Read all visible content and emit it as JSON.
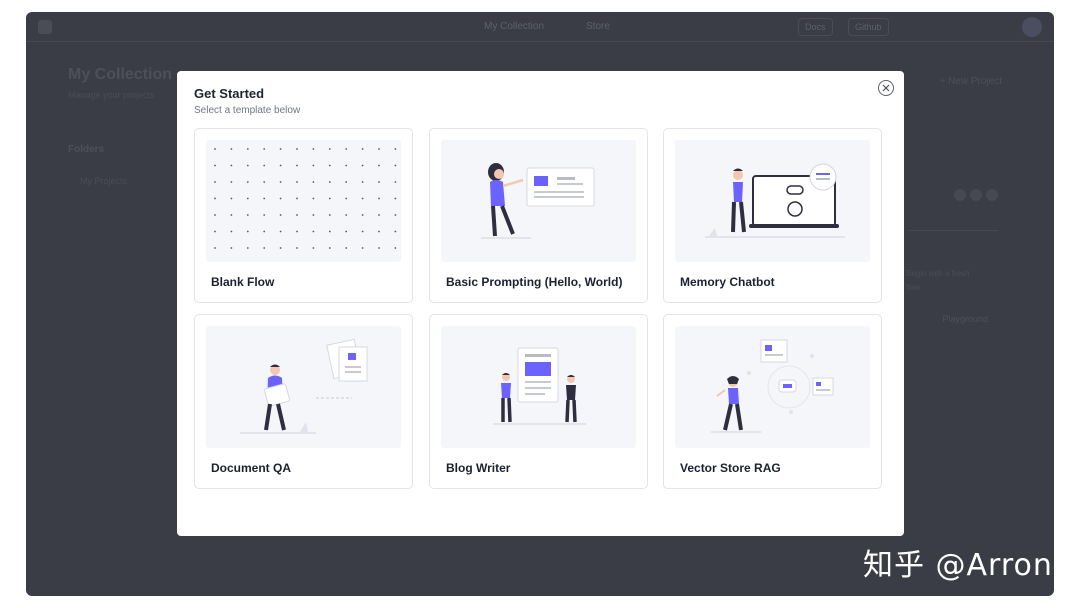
{
  "background_app": {
    "nav": [
      "My Collection",
      "Store"
    ],
    "top_pills": [
      "Docs",
      "Github"
    ],
    "page_title": "My Collection",
    "page_subtitle": "Manage your projects",
    "folders_heading": "Folders",
    "folder_item": "My Projects",
    "new_project_label": "+ New Project",
    "right_text": "Begin with a fresh flow",
    "right_button": "Playground"
  },
  "modal": {
    "title": "Get Started",
    "subtitle": "Select a template below",
    "close_icon": "close-icon",
    "templates": [
      {
        "label": "Blank Flow",
        "illustration": "dot-grid"
      },
      {
        "label": "Basic Prompting (Hello, World)",
        "illustration": "person-presenting-board"
      },
      {
        "label": "Memory Chatbot",
        "illustration": "person-with-laptop-bot"
      },
      {
        "label": "Document QA",
        "illustration": "person-holding-document"
      },
      {
        "label": "Blog Writer",
        "illustration": "two-people-with-document"
      },
      {
        "label": "Vector Store RAG",
        "illustration": "person-with-floating-cards"
      }
    ]
  },
  "watermark": "知乎 @Arron",
  "colors": {
    "accent": "#6c63ff",
    "overlay": "#3a3d46",
    "card_border": "#e2e4e9",
    "thumb_bg": "#f5f6f9",
    "figure_dark": "#2f2e41"
  }
}
